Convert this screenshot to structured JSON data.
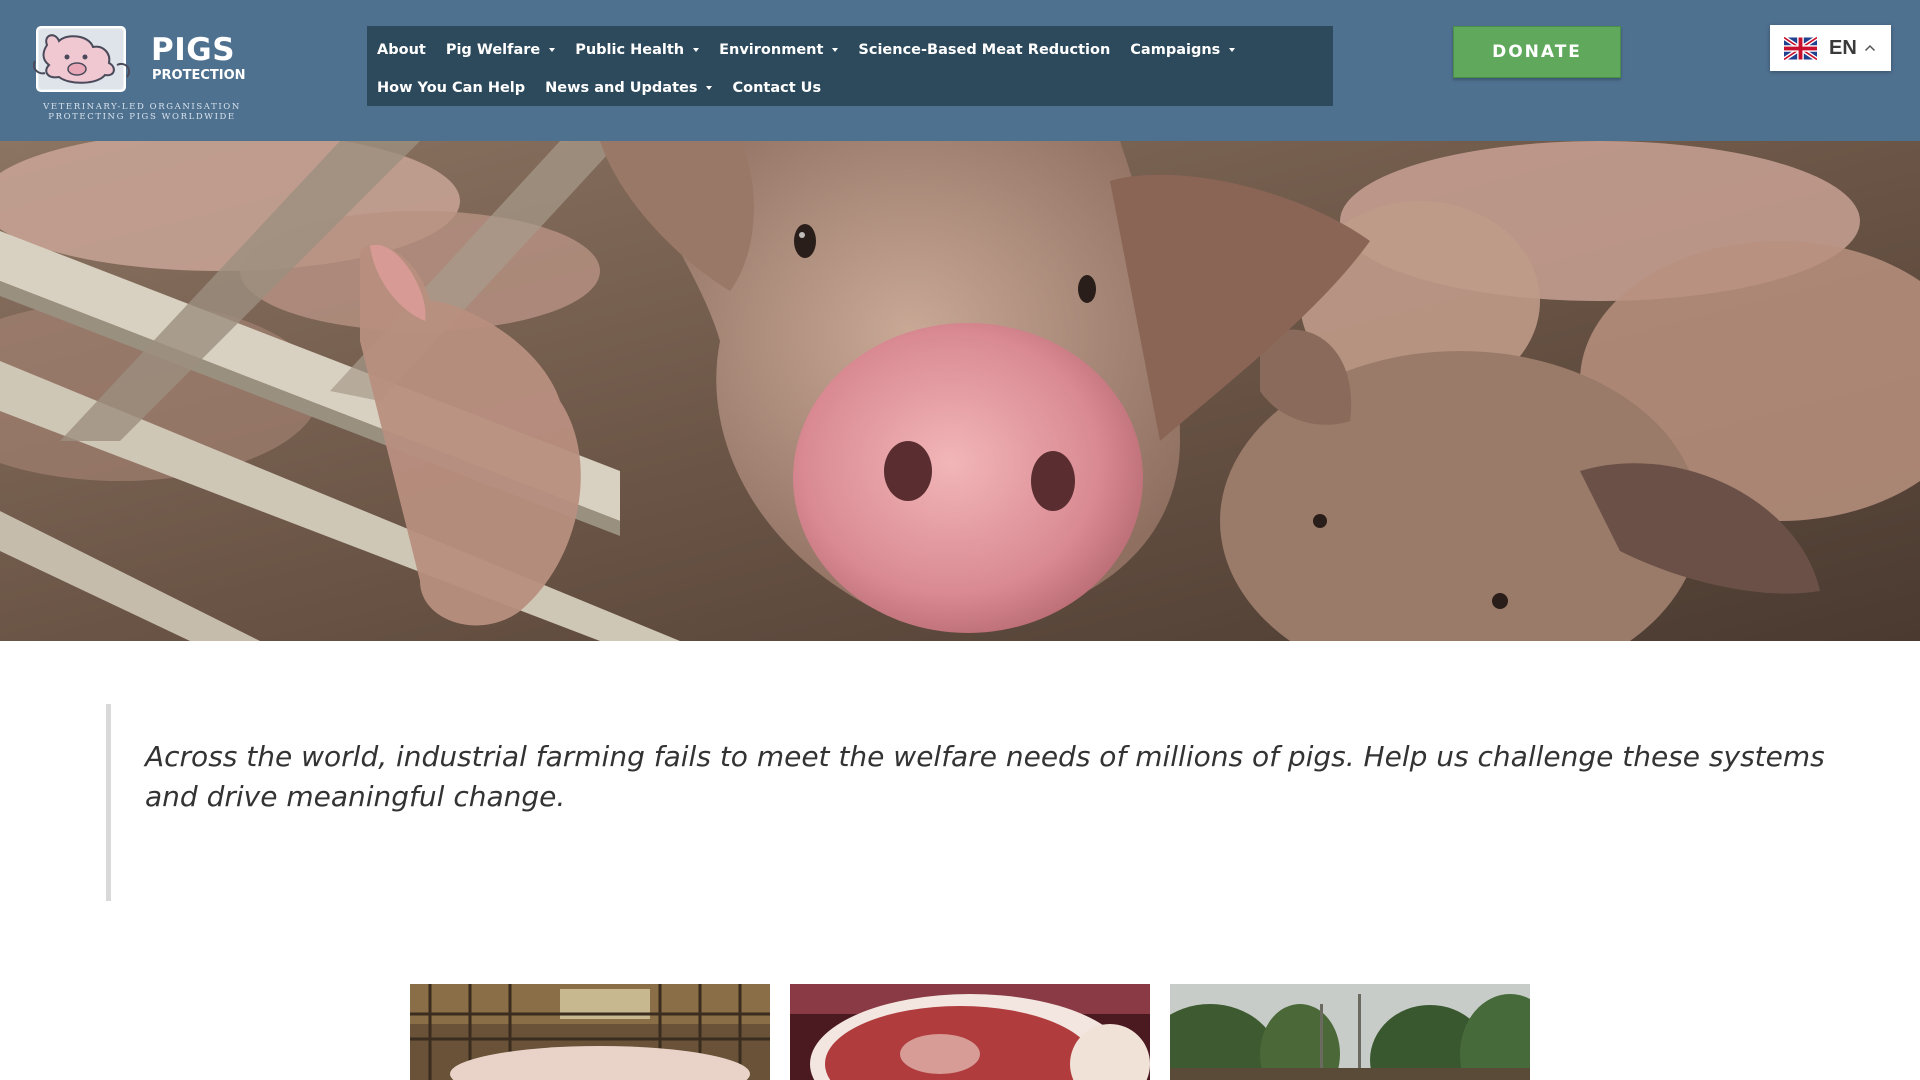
{
  "brand": {
    "name_line1": "PIGS",
    "name_line2": "PROTECTION",
    "tagline_line1": "VETERINARY-LED ORGANISATION",
    "tagline_line2": "PROTECTING PIGS WORLDWIDE"
  },
  "nav": {
    "row1": [
      {
        "label": "About",
        "has_dropdown": false
      },
      {
        "label": "Pig Welfare",
        "has_dropdown": true
      },
      {
        "label": "Public Health",
        "has_dropdown": true
      },
      {
        "label": "Environment",
        "has_dropdown": true
      },
      {
        "label": "Science-Based Meat Reduction",
        "has_dropdown": false
      },
      {
        "label": "Campaigns",
        "has_dropdown": true
      }
    ],
    "row2": [
      {
        "label": "How You Can Help",
        "has_dropdown": false
      },
      {
        "label": "News and Updates",
        "has_dropdown": true
      },
      {
        "label": "Contact Us",
        "has_dropdown": false
      }
    ]
  },
  "donate_label": "DONATE",
  "language": {
    "code": "EN",
    "flag_icon": "uk-flag-icon"
  },
  "quote": "Across the world, industrial farming fails to meet the welfare needs of millions of pigs. Help us challenge these systems and drive meaningful change.",
  "colors": {
    "header_bg": "#4f7190",
    "nav_bg": "#2d4a5c",
    "donate_bg": "#5fa85c",
    "quote_text": "#333333"
  },
  "cards": [
    {
      "image": "pigs-in-farm-pen-image"
    },
    {
      "image": "raw-pork-meat-image"
    },
    {
      "image": "deforested-landscape-image"
    }
  ]
}
